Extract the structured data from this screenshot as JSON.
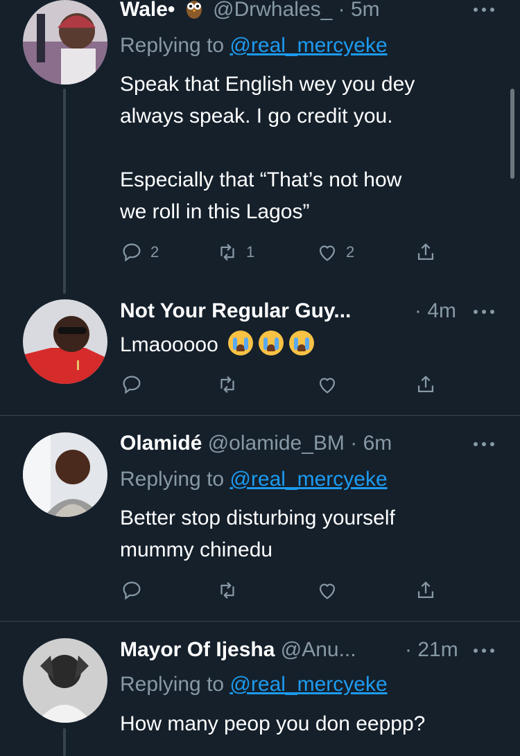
{
  "tweets": [
    {
      "name": "Wale•",
      "handle": "@Drwhales_",
      "time": "· 5m",
      "replying_prefix": "Replying to ",
      "replying_to": "@real_mercyeke",
      "text": "Speak that English wey you dey\nalways speak. I go credit you.\n\nEspecially that “That’s not how\nwe roll in this Lagos”",
      "replies": "2",
      "retweets": "1",
      "likes": "2"
    },
    {
      "name": "Not Your Regular Guy...",
      "handle": "",
      "time": "· 4m",
      "text": "Lmaooooo",
      "emojis": [
        "loudly-crying-face-icon",
        "loudly-crying-face-icon",
        "loudly-crying-face-icon"
      ]
    },
    {
      "name": "Olamidé",
      "handle": "@olamide_BM",
      "time": "· 6m",
      "replying_prefix": "Replying to ",
      "replying_to": "@real_mercyeke",
      "text": "Better stop disturbing yourself\nmummy  chinedu"
    },
    {
      "name": "Mayor Of Ijesha",
      "handle": "@Anu...",
      "time": "· 21m",
      "replying_prefix": "Replying to ",
      "replying_to": "@real_mercyeke",
      "text": "How many peop you don eeppp?"
    }
  ],
  "colors": {
    "background": "#15202b",
    "secondary_text": "#8899a6",
    "link": "#1d9bf0",
    "divider": "#38444d"
  },
  "icons": {
    "reply": "reply-icon",
    "retweet": "retweet-icon",
    "like": "heart-icon",
    "share": "share-icon",
    "more": "more-options-icon",
    "owl": "owl-emoji-icon"
  }
}
